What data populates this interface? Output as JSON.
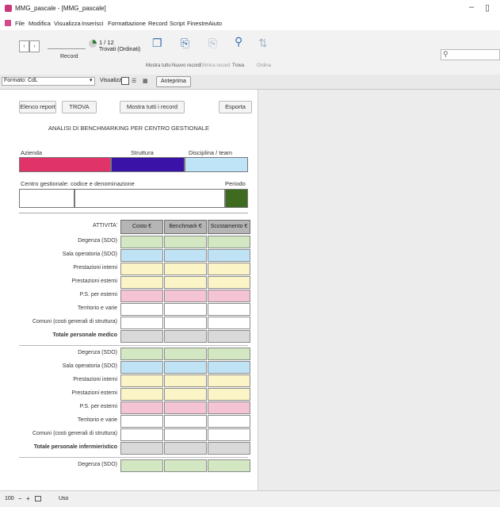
{
  "window": {
    "title": "MMG_pascale - [MMG_pascale]",
    "minimize": "–",
    "maximize": "▯"
  },
  "menu": [
    "File",
    "Modifica",
    "Visualizza",
    "Inserisci",
    "Formattazione",
    "Record",
    "Script",
    "Finestre",
    "Aiuto"
  ],
  "toolbar": {
    "record_counter": "1 / 12",
    "record_found": "Trovati (Ordinati)",
    "record_label": "Record",
    "tools": [
      "Mostra tutto",
      "Nuovo record",
      "Elimina record",
      "Trova",
      "Ordina"
    ],
    "search_placeholder": ""
  },
  "layoutbar": {
    "layout_label": "Formato: CdL",
    "view_label": "Visualizza",
    "preview_button": "Anteprima"
  },
  "form": {
    "buttons": [
      "Elenco report",
      "TROVA",
      "Mostra tutti i record",
      "Esporta"
    ],
    "heading": "ANALISI DI BENCHMARKING PER CENTRO GESTIONALE",
    "field_labels": {
      "azienda": "Azienda",
      "struttura": "Struttura",
      "disciplina": "Disciplina / team",
      "centro": "Centro gestionale: codice e denominazione",
      "periodo": "Periodo"
    },
    "colors": {
      "azienda": "#e0336a",
      "struttura": "#3b12a8",
      "disciplina": "#bfe3f7",
      "periodo": "#3f6b21",
      "green": "#d2e7c2",
      "blue": "#bfe3f4",
      "yellow": "#fbf4c6",
      "pink": "#f4c4d4",
      "white": "#ffffff",
      "gray": "#d9d9d9"
    },
    "table": {
      "corner_label": "ATTIVITA'",
      "columns": [
        "Costo €",
        "Benchmark €",
        "Scostamento €"
      ],
      "sections": [
        {
          "rows": [
            {
              "label": "Degenza (SDO)",
              "color": "green"
            },
            {
              "label": "Sala operatoria (SDO)",
              "color": "blue"
            },
            {
              "label": "Prestazioni interni",
              "color": "yellow"
            },
            {
              "label": "Prestazioni esterni",
              "color": "yellow"
            },
            {
              "label": "P.S. per esterni",
              "color": "pink"
            },
            {
              "label": "Territorio e varie",
              "color": "white"
            },
            {
              "label": "Comuni (costi generali di struttura)",
              "color": "white"
            },
            {
              "label": "Totale personale medico",
              "color": "gray",
              "total": true
            }
          ]
        },
        {
          "rows": [
            {
              "label": "Degenza (SDO)",
              "color": "green"
            },
            {
              "label": "Sala operatoria (SDO)",
              "color": "blue"
            },
            {
              "label": "Prestazioni interni",
              "color": "yellow"
            },
            {
              "label": "Prestazioni esterni",
              "color": "yellow"
            },
            {
              "label": "P.S. per esterni",
              "color": "pink"
            },
            {
              "label": "Territorio e varie",
              "color": "white"
            },
            {
              "label": "Comuni (costi generali di struttura)",
              "color": "white"
            },
            {
              "label": "Totale personale infermieristico",
              "color": "gray",
              "total": true
            }
          ]
        },
        {
          "rows": [
            {
              "label": "Degenza (SDO)",
              "color": "green"
            }
          ]
        }
      ]
    }
  },
  "status": {
    "zoom": "100",
    "mode": "Uso"
  }
}
